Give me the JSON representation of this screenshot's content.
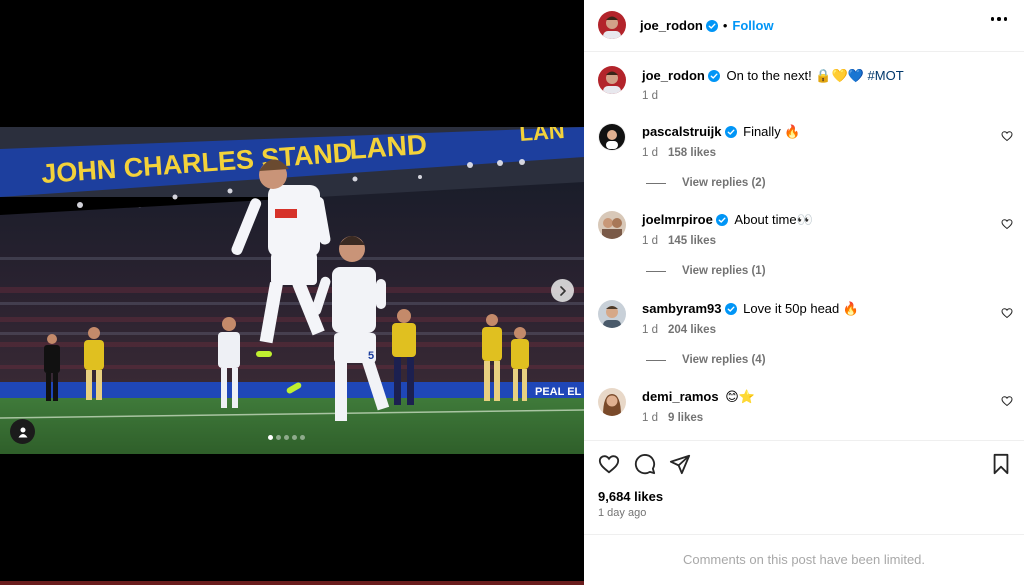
{
  "header": {
    "username": "joe_rodon",
    "separator": "•",
    "follow_label": "Follow"
  },
  "caption": {
    "username": "joe_rodon",
    "text": "On to the next! 🔒💛💙",
    "hashtag": "#MOT",
    "time": "1 d"
  },
  "comments": [
    {
      "username": "pascalstruijk",
      "text": "Finally 🔥",
      "time": "1 d",
      "likes": "158 likes",
      "replies": "View replies (2)"
    },
    {
      "username": "joelmrpiroe",
      "text": "About time👀",
      "time": "1 d",
      "likes": "145 likes",
      "replies": "View replies (1)"
    },
    {
      "username": "sambyram93",
      "text": "Love it 50p head 🔥",
      "time": "1 d",
      "likes": "204 likes",
      "replies": "View replies (4)"
    },
    {
      "username": "demi_ramos",
      "text": "😊⭐",
      "time": "1 d",
      "likes": "9 likes"
    }
  ],
  "footer": {
    "likes": "9,684 likes",
    "time_ago": "1 day ago",
    "limited_notice": "Comments on this post have been limited."
  },
  "photo": {
    "stand_text": "JOHN CHARLES STAND",
    "land_text": "LAND",
    "land_text_2": "LAN",
    "ad_text": "PEAL EL",
    "carousel_total": 5,
    "carousel_active": 1
  },
  "colors": {
    "follow": "#0095f6",
    "verified": "#0095f6",
    "hashtag": "#00376b",
    "meta": "#737373"
  },
  "icons": [
    "verified-badge-icon",
    "more-options-icon",
    "heart-icon",
    "comment-icon",
    "share-icon",
    "bookmark-icon",
    "chevron-right-icon",
    "user-tag-icon"
  ]
}
